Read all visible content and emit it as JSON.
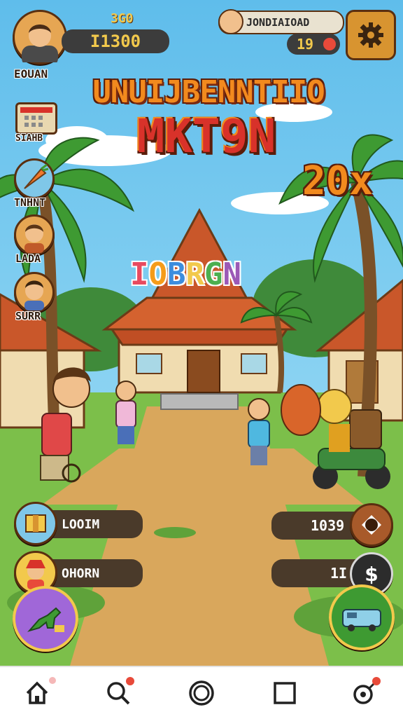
{
  "hud": {
    "player_name": "EOUAN",
    "small_stat": "3G0",
    "currency": "I1300",
    "quest_title": "JONDIAIOAD",
    "quest_count": "19",
    "settings_icon": "gear-icon"
  },
  "banner": {
    "line1": "UNUIJBENNTIIO",
    "line2": "MKT9N",
    "multiplier": "20x",
    "rainbow_text": "IOBRGN",
    "rainbow_colors": [
      "#e84a5f",
      "#f59c1a",
      "#3c8dde",
      "#f2c94c",
      "#4caf50",
      "#9b59b6"
    ]
  },
  "sidebar": [
    {
      "label": "SIAHB",
      "icon": "shop-stall-icon"
    },
    {
      "label": "TNHNT",
      "icon": "carrot-icon"
    },
    {
      "label": "LADA",
      "icon": "villager-avatar-icon"
    },
    {
      "label": "SURR",
      "icon": "villager-avatar-icon"
    }
  ],
  "actions_left": [
    {
      "label": "LOOIM",
      "icon": "package-icon"
    },
    {
      "label": "OHORN",
      "icon": "merchant-icon"
    }
  ],
  "actions_right": [
    {
      "value": "1039",
      "icon": "stop-icon"
    },
    {
      "value": "1I",
      "icon": "dollar-icon"
    }
  ],
  "big_buttons": {
    "left_icon": "dinosaur-icon",
    "right_icon": "van-icon"
  },
  "nav": [
    {
      "name": "home",
      "icon": "home-icon",
      "badge": true
    },
    {
      "name": "search",
      "icon": "search-icon",
      "badge": true
    },
    {
      "name": "circle",
      "icon": "circle-icon",
      "badge": false
    },
    {
      "name": "square",
      "icon": "square-icon",
      "badge": false
    },
    {
      "name": "profile",
      "icon": "target-icon",
      "badge": true
    }
  ],
  "colors": {
    "title_orange": "#f28a1e",
    "title_red": "#d8322a",
    "outline": "#5a2f10",
    "pill_bg": "#3c3c3c",
    "gold": "#f2c94c"
  }
}
